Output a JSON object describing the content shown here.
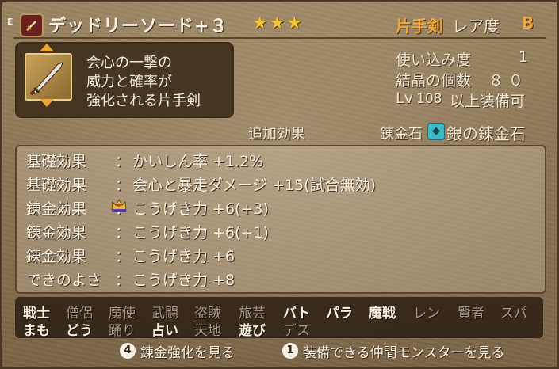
{
  "header": {
    "equip_badge": "E",
    "item_name": "デッドリーソード+３",
    "stars": "★★★",
    "weapon_type": "片手剣",
    "rarity_label": "レア度",
    "rarity": "B"
  },
  "description": {
    "lines": [
      "会心の一撃の",
      "威力と確率が",
      "強化される片手剣"
    ]
  },
  "stats": {
    "usage_label": "使い込み度",
    "usage_value": "1",
    "crystal_label": "結晶の個数",
    "crystal_value": "８０",
    "level_prefix": "Lv",
    "level_value": "108",
    "level_suffix": "以上装備可"
  },
  "effects_header": {
    "additional_effects": "追加効果",
    "alchemy_stone_label": "錬金石",
    "alchemy_stone_icon": "alchemy-stone-icon",
    "alchemy_stone_name": "銀の錬金石"
  },
  "effects": [
    {
      "label": "基礎効果",
      "value": "かいしん率 +1.2%"
    },
    {
      "label": "基礎効果",
      "value": "会心と暴走ダメージ +15(試合無効)"
    },
    {
      "label": "錬金効果",
      "value": "こうげき力 +6(+3)"
    },
    {
      "label": "錬金効果",
      "value": "こうげき力 +6(+1)"
    },
    {
      "label": "錬金効果",
      "value": "こうげき力 +6"
    },
    {
      "label": "できのよさ",
      "value": "こうげき力 +8"
    }
  ],
  "effect_colon": "：",
  "jobs": [
    {
      "name": "戦士",
      "on": true
    },
    {
      "name": "僧侶",
      "on": false
    },
    {
      "name": "魔使",
      "on": false
    },
    {
      "name": "武闘",
      "on": false
    },
    {
      "name": "盗賊",
      "on": false
    },
    {
      "name": "旅芸",
      "on": false
    },
    {
      "name": "バト",
      "on": true
    },
    {
      "name": "パラ",
      "on": true
    },
    {
      "name": "魔戦",
      "on": true
    },
    {
      "name": "レン",
      "on": false
    },
    {
      "name": "賢者",
      "on": false
    },
    {
      "name": "スパ",
      "on": false
    },
    {
      "name": "まも",
      "on": true
    },
    {
      "name": "どう",
      "on": true
    },
    {
      "name": "踊り",
      "on": false
    },
    {
      "name": "占い",
      "on": true
    },
    {
      "name": "天地",
      "on": false
    },
    {
      "name": "遊び",
      "on": true
    },
    {
      "name": "デス",
      "on": false
    }
  ],
  "hints": {
    "btn4": "4",
    "alchemy_view": "錬金強化を見る",
    "btn1": "1",
    "monster_view": "装備できる仲間モンスターを見る"
  },
  "colors": {
    "accent_orange": "#f3a63a",
    "star_gold": "#f2c53d",
    "job_on": "#f6f0e2",
    "job_off": "#a8998a"
  }
}
